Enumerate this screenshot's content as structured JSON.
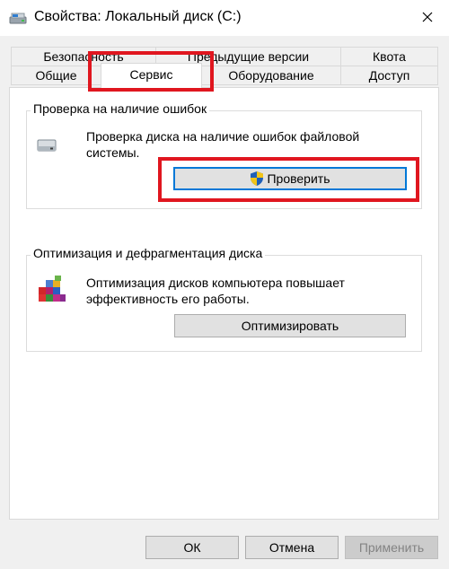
{
  "window": {
    "title": "Свойства: Локальный диск (C:)"
  },
  "tabs": {
    "row1": [
      {
        "label": "Безопасность"
      },
      {
        "label": "Предыдущие версии"
      },
      {
        "label": "Квота"
      }
    ],
    "row2": [
      {
        "label": "Общие"
      },
      {
        "label": "Сервис",
        "active": true
      },
      {
        "label": "Оборудование"
      },
      {
        "label": "Доступ"
      }
    ]
  },
  "check_group": {
    "title": "Проверка на наличие ошибок",
    "description": "Проверка диска на наличие ошибок файловой системы.",
    "button_label": "Проверить",
    "icon": "drive-icon",
    "button_icon": "uac-shield-icon"
  },
  "optimize_group": {
    "title": "Оптимизация и дефрагментация диска",
    "description": "Оптимизация дисков компьютера повышает эффективность его работы.",
    "button_label": "Оптимизировать",
    "icon": "defrag-icon"
  },
  "footer": {
    "ok_label": "ОК",
    "cancel_label": "Отмена",
    "apply_label": "Применить"
  },
  "colors": {
    "highlight": "#e0161f",
    "focus": "#0078d7"
  }
}
